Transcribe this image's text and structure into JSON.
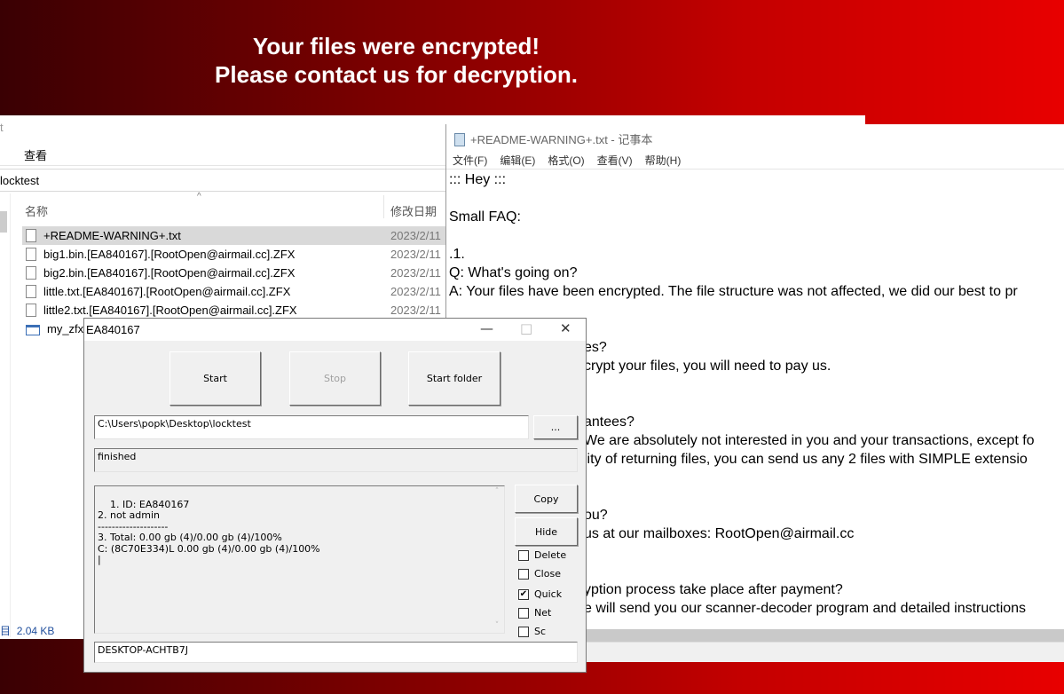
{
  "banner": {
    "line1": "Your files were encrypted!",
    "line2": "Please contact us for decryption."
  },
  "explorer": {
    "title_fragment": "t",
    "ribbon_tab": "查看",
    "address": "locktest",
    "columns": {
      "name": "名称",
      "modified": "修改日期"
    },
    "files": [
      {
        "name": "+README-WARNING+.txt",
        "date": "2023/2/11",
        "selected": true,
        "icon": "text-file-icon"
      },
      {
        "name": "big1.bin.[EA840167].[RootOpen@airmail.cc].ZFX",
        "date": "2023/2/11",
        "icon": "file-icon"
      },
      {
        "name": "big2.bin.[EA840167].[RootOpen@airmail.cc].ZFX",
        "date": "2023/2/11",
        "icon": "file-icon"
      },
      {
        "name": "little.txt.[EA840167].[RootOpen@airmail.cc].ZFX",
        "date": "2023/2/11",
        "icon": "file-icon"
      },
      {
        "name": "little2.txt.[EA840167].[RootOpen@airmail.cc].ZFX",
        "date": "2023/2/11",
        "icon": "file-icon"
      },
      {
        "name": "my_zfx_",
        "date": "",
        "icon": "executable-icon"
      }
    ],
    "status_left": "目",
    "status_size": "2.04 KB"
  },
  "notepad": {
    "title": "+README-WARNING+.txt - 记事本",
    "menu": [
      "文件(F)",
      "编辑(E)",
      "格式(O)",
      "查看(V)",
      "帮助(H)"
    ],
    "lines": [
      "::: Hey :::",
      "",
      "Small FAQ:",
      "",
      ".1.",
      "Q: What's going on?",
      "A: Your files have been encrypted. The file structure was not affected, we did our best to pr"
    ],
    "partial_lines": [
      "",
      "",
      "es?",
      "crypt your files, you will need to pay us.",
      "",
      "",
      "antees?",
      "We are absolutely not interested in you and your transactions, except fo",
      "lity of returning files, you can send us any 2 files with SIMPLE extensio",
      "",
      "",
      "ou?",
      "us at our mailboxes: RootOpen@airmail.cc",
      "",
      "",
      "yption process take place after payment?",
      "e will send you our scanner-decoder program and detailed instructions"
    ]
  },
  "dialog": {
    "title": "EA840167",
    "buttons": {
      "start": "Start",
      "stop": "Stop",
      "start_folder": "Start folder",
      "browse": "...",
      "copy": "Copy",
      "hide": "Hide"
    },
    "path": "C:\\Users\\popk\\Desktop\\locktest",
    "status": "finished",
    "log": "1. ID: EA840167\n2. not admin\n--------------------\n3. Total: 0.00 gb (4)/0.00 gb (4)/100%\nC: (8C70E334)L 0.00 gb (4)/0.00 gb (4)/100%\n|",
    "options": [
      {
        "label": "Delete",
        "checked": false
      },
      {
        "label": "Close",
        "checked": false
      },
      {
        "label": "Quick",
        "checked": true
      },
      {
        "label": "Net",
        "checked": false
      },
      {
        "label": "Sc",
        "checked": false
      }
    ],
    "computer_name": "DESKTOP-ACHTB7J"
  }
}
